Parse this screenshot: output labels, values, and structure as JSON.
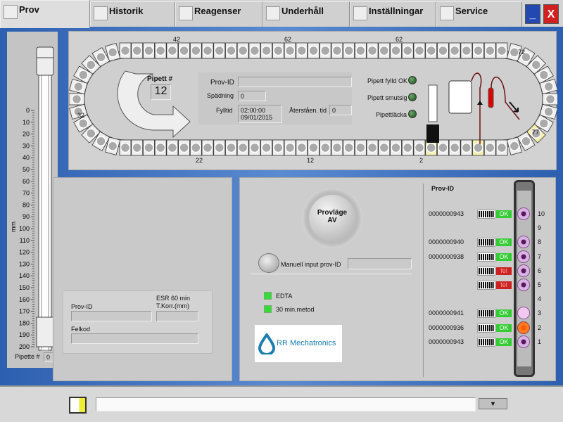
{
  "tabs": [
    {
      "label": "Prov",
      "selected": true
    },
    {
      "label": "Historik"
    },
    {
      "label": "Reagenser"
    },
    {
      "label": "Underhåll"
    },
    {
      "label": "Inställningar"
    },
    {
      "label": "Service"
    }
  ],
  "window": {
    "minimize": "_",
    "close": "X"
  },
  "carousel": {
    "labels_top": [
      "42",
      "62",
      "62"
    ],
    "labels_bottom": [
      "22",
      "12",
      "2"
    ],
    "label_left": "32",
    "label_right_top": "72",
    "label_right_bottom": "77",
    "pipett_label": "Pipett #",
    "pipett_value": "12",
    "prov_id_label": "Prov-ID",
    "prov_id_value": "",
    "spadning_label": "Spädning",
    "spadning_value": "0",
    "fylltid_label": "Fylltid",
    "fylltid_time": "02:00:00",
    "fylltid_date": "09/01/2015",
    "aterstaende_label": "Återståen. tid",
    "aterstaende_value": "0",
    "indicators": [
      {
        "label": "Pipett fylld OK"
      },
      {
        "label": "Pipett smutsig"
      },
      {
        "label": "Pipettläcka"
      }
    ]
  },
  "tube": {
    "unit": "mm",
    "ticks": [
      "0",
      "10",
      "20",
      "30",
      "40",
      "50",
      "60",
      "70",
      "80",
      "90",
      "100",
      "110",
      "120",
      "130",
      "140",
      "150",
      "160",
      "170",
      "180",
      "190",
      "200"
    ],
    "level_mm": 175,
    "pipette_label": "Pipette #",
    "pipette_value": "0"
  },
  "result": {
    "prov_id_label": "Prov-ID",
    "prov_id_value": "",
    "esr_label_1": "ESR 60 min",
    "esr_label_2": "T.Korr.(mm)",
    "esr_value": "",
    "felkod_label": "Felkod",
    "felkod_value": ""
  },
  "controls": {
    "provlage_1": "Provläge",
    "provlage_2": "AV",
    "manual_label": "Manuell input prov-ID",
    "manual_value": "",
    "edta": "EDTA",
    "metod": "30 min.metod",
    "logo": "RR Mechatronics",
    "brand_color": "#1a7fb0"
  },
  "rack": {
    "header": "Prov-ID",
    "rows": [
      {
        "pos": "10",
        "id": "0000000943",
        "status": "OK",
        "tube": "purple"
      },
      {
        "pos": "9",
        "id": "",
        "status": "",
        "tube": ""
      },
      {
        "pos": "8",
        "id": "0000000940",
        "status": "OK",
        "tube": "purple"
      },
      {
        "pos": "7",
        "id": "0000000938",
        "status": "OK",
        "tube": "purple"
      },
      {
        "pos": "6",
        "id": "",
        "status": "fel",
        "tube": "purple"
      },
      {
        "pos": "5",
        "id": "",
        "status": "fel",
        "tube": "purple"
      },
      {
        "pos": "4",
        "id": "",
        "status": "",
        "tube": ""
      },
      {
        "pos": "3",
        "id": "0000000941",
        "status": "OK",
        "tube": "pink"
      },
      {
        "pos": "2",
        "id": "0000000936",
        "status": "OK",
        "tube": "orange"
      },
      {
        "pos": "1",
        "id": "0000000943",
        "status": "OK",
        "tube": "purple"
      }
    ]
  },
  "statusbar": {
    "message": ""
  }
}
